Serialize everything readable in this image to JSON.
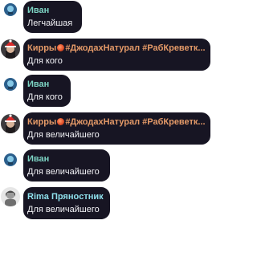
{
  "colors": {
    "bubble_bg": "#171523",
    "text": "#f2f2f6",
    "name_ivan": "#7dd4c4",
    "name_kirr": "#e59a68",
    "name_rima": "#8fe0ec"
  },
  "messages": [
    {
      "author": "Иван",
      "text": "Легчайшая",
      "avatar": "blue-robot-avatar"
    },
    {
      "author_pre": "Кирры",
      "author_post": "#ДжодахНатурал #РабКреветк...",
      "flame_icon": "flame-icon",
      "text": "Для кого",
      "avatar": "santa-hat-avatar"
    },
    {
      "author": "Иван",
      "text": "Для кого",
      "avatar": "blue-robot-avatar"
    },
    {
      "author_pre": "Кирры",
      "author_post": "#ДжодахНатурал #РабКреветк...",
      "flame_icon": "flame-icon",
      "text": "Для величайшего",
      "avatar": "santa-hat-avatar"
    },
    {
      "author": "Иван",
      "text": "Для величайшего",
      "avatar": "blue-robot-avatar"
    },
    {
      "author": "Rima Прянoстник",
      "text": "Для величайшего",
      "avatar": "grey-portrait-avatar"
    }
  ]
}
